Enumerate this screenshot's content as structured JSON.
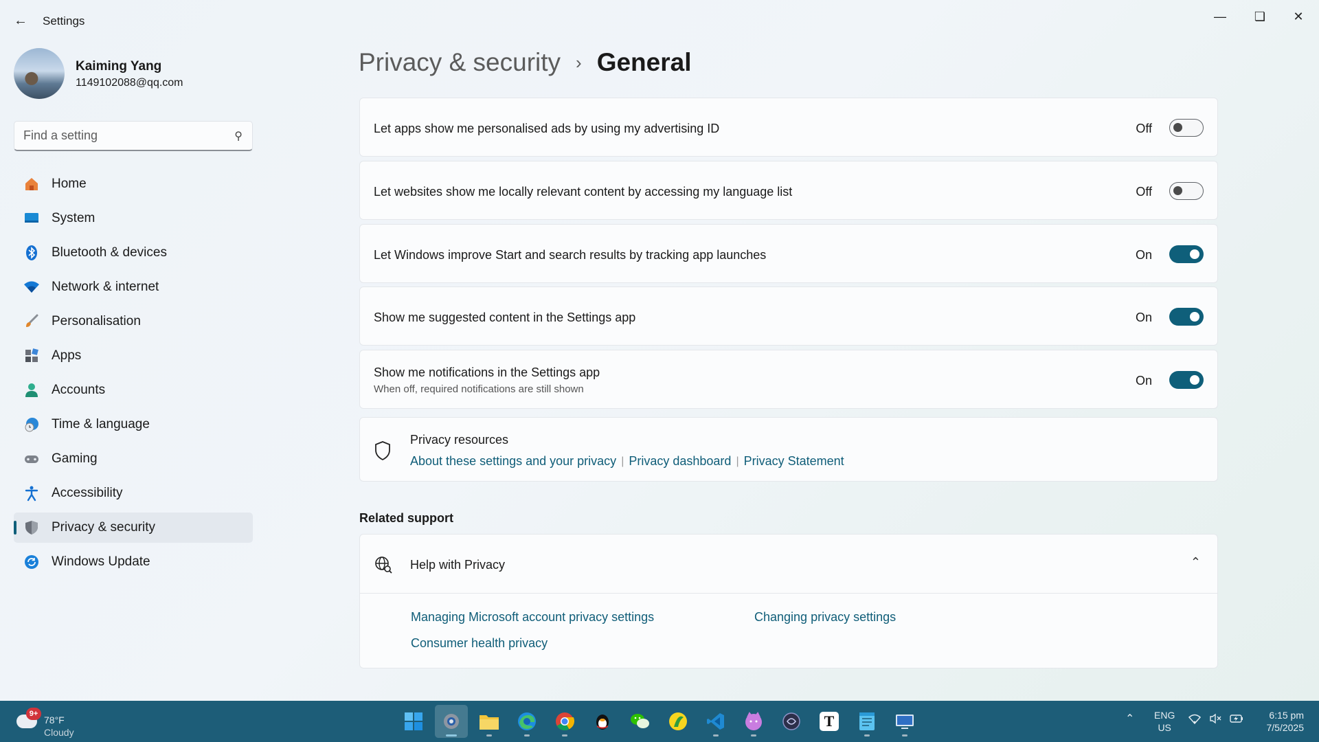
{
  "window": {
    "title": "Settings"
  },
  "profile": {
    "name": "Kaiming Yang",
    "email": "1149102088@qq.com"
  },
  "search": {
    "placeholder": "Find a setting"
  },
  "sidebar": {
    "items": [
      {
        "label": "Home",
        "icon": "home-icon"
      },
      {
        "label": "System",
        "icon": "system-icon"
      },
      {
        "label": "Bluetooth & devices",
        "icon": "bluetooth-icon"
      },
      {
        "label": "Network & internet",
        "icon": "wifi-icon"
      },
      {
        "label": "Personalisation",
        "icon": "brush-icon"
      },
      {
        "label": "Apps",
        "icon": "apps-icon"
      },
      {
        "label": "Accounts",
        "icon": "accounts-icon"
      },
      {
        "label": "Time & language",
        "icon": "time-language-icon"
      },
      {
        "label": "Gaming",
        "icon": "gamepad-icon"
      },
      {
        "label": "Accessibility",
        "icon": "accessibility-icon"
      },
      {
        "label": "Privacy & security",
        "icon": "shield-icon",
        "active": true
      },
      {
        "label": "Windows Update",
        "icon": "update-icon"
      }
    ]
  },
  "breadcrumb": {
    "parent": "Privacy & security",
    "current": "General"
  },
  "settings": [
    {
      "label": "Let apps show me personalised ads by using my advertising ID",
      "state": "Off"
    },
    {
      "label": "Let websites show me locally relevant content by accessing my language list",
      "state": "Off"
    },
    {
      "label": "Let Windows improve Start and search results by tracking app launches",
      "state": "On"
    },
    {
      "label": "Show me suggested content in the Settings app",
      "state": "On"
    },
    {
      "label": "Show me notifications in the Settings app",
      "sublabel": "When off, required notifications are still shown",
      "state": "On"
    }
  ],
  "privacy_resources": {
    "title": "Privacy resources",
    "links": [
      "About these settings and your privacy",
      "Privacy dashboard",
      "Privacy Statement"
    ]
  },
  "related_support": {
    "title": "Related support",
    "help_title": "Help with Privacy",
    "links": [
      "Managing Microsoft account privacy settings",
      "Changing privacy settings",
      "Consumer health privacy"
    ]
  },
  "taskbar": {
    "weather": {
      "badge": "9+",
      "temp": "78°F",
      "condition": "Cloudy"
    },
    "lang": {
      "line1": "ENG",
      "line2": "US"
    },
    "time": "6:15 pm",
    "date": "7/5/2025",
    "apps": [
      "start-icon",
      "settings-icon",
      "file-explorer-icon",
      "edge-icon",
      "chrome-icon",
      "qq-icon",
      "wechat-icon",
      "app-icon",
      "vscode-icon",
      "cat-app-icon",
      "app-icon",
      "typora-icon",
      "notepad-icon",
      "remote-desktop-icon"
    ]
  },
  "colors": {
    "accent": "#0f5f7a",
    "link": "#0f5d78",
    "taskbar": "#1d5d78"
  }
}
